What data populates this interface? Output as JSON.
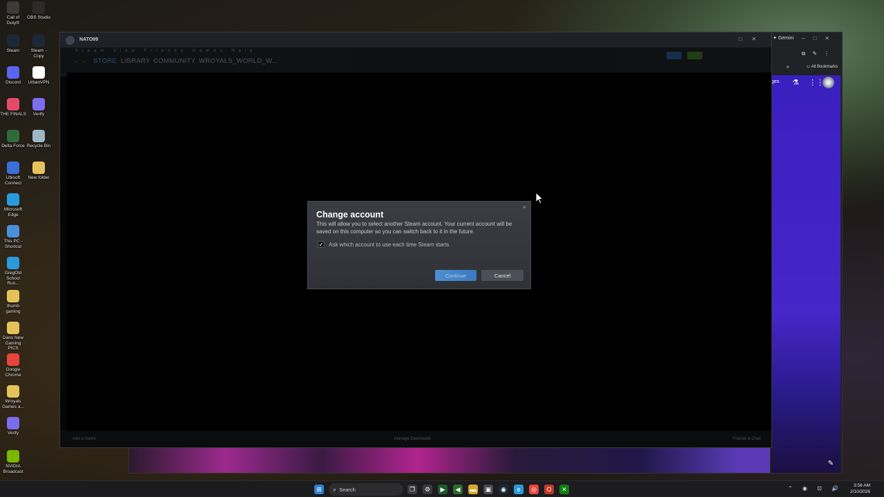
{
  "desktop_icons": [
    {
      "label": "Call of Duty®",
      "color": "#3b3b3b"
    },
    {
      "label": "OBS Studio",
      "color": "#2b2b2b"
    },
    {
      "label": "Steam",
      "color": "#1b2838"
    },
    {
      "label": "Steam - Copy",
      "color": "#1b2838"
    },
    {
      "label": "Discord",
      "color": "#5865f2"
    },
    {
      "label": "UrbanVPN",
      "color": "#ffffff"
    },
    {
      "label": "THE FINALS",
      "color": "#e64a6a"
    },
    {
      "label": "Verify",
      "color": "#7a6df0"
    },
    {
      "label": "Delta Force",
      "color": "#2f6b3a"
    },
    {
      "label": "Recycle Bin",
      "color": "#9fb8c8"
    },
    {
      "label": "Ubisoft Connect",
      "color": "#3a6fd8"
    },
    {
      "label": "New folder",
      "color": "#e6c35a"
    },
    {
      "label": "Microsoft Edge",
      "color": "#2a9adf"
    },
    {
      "label": "This PC - Shortcut",
      "color": "#4a90d9"
    },
    {
      "label": "GregOld School Run...",
      "color": "#2a9adf"
    },
    {
      "label": "thumb gaming",
      "color": "#e6c35a"
    },
    {
      "label": "Dans New Gaming PICS",
      "color": "#e6c35a"
    },
    {
      "label": "Google Chrome",
      "color": "#e8453c"
    },
    {
      "label": "Wroyals Games a...",
      "color": "#e6c35a"
    },
    {
      "label": "Verify",
      "color": "#7a6df0"
    },
    {
      "label": "NVIDIA Broadcast",
      "color": "#76b900"
    }
  ],
  "chrome": {
    "gemini_tab": "✦ Gemini",
    "bookmarks": "All Bookmarks",
    "page_text": "ges"
  },
  "steam": {
    "window_title": "NATO99",
    "menu": "Steam  View  Friends  Games  Help",
    "nav": {
      "store": "STORE",
      "library": "LIBRARY",
      "community": "COMMUNITY",
      "profile": "WROYALS_WORLD_W..."
    },
    "status_left": "Add a Game",
    "status_mid": "Manage Downloads",
    "status_right": "Friends & Chat"
  },
  "dialog": {
    "title": "Change account",
    "message": "This will allow you to select another Steam account. Your current account will be saved on this computer so you can switch back to it in the future.",
    "checkbox_label": "Ask which account to use each time Steam starts",
    "checkbox_checked": true,
    "continue_label": "Continue",
    "cancel_label": "Cancel",
    "close_glyph": "×"
  },
  "taskbar": {
    "search_placeholder": "Search",
    "time": "3:56 AM",
    "date": "2/10/2026"
  }
}
